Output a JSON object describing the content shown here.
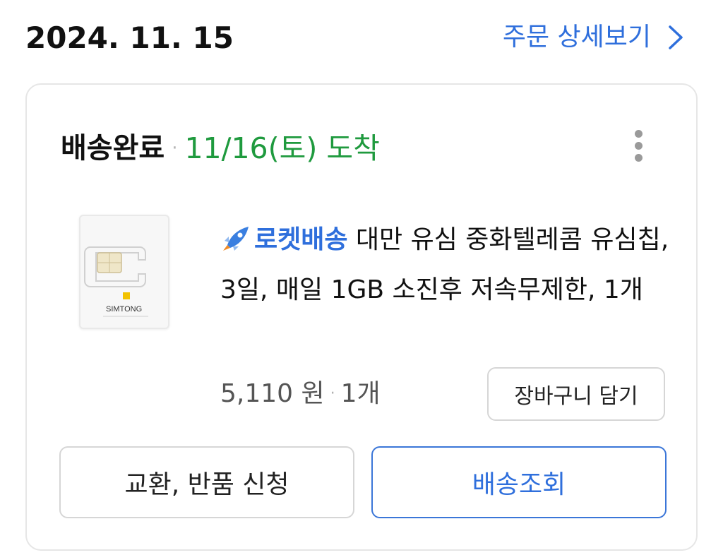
{
  "order": {
    "date": "2024. 11. 15",
    "detail_link": "주문 상세보기"
  },
  "shipment": {
    "status": "배송완료",
    "separator": "·",
    "arrival": "11/16(토) 도착"
  },
  "product": {
    "thumbnail_brand": "SIMTONG",
    "badge": "로켓배송",
    "title": "대만 유심 중화텔레콤 유심칩, 3일, 매일 1GB 소진후 저속무제한, 1개",
    "price": "5,110 원",
    "price_separator": "·",
    "quantity": "1개"
  },
  "actions": {
    "add_to_cart": "장바구니 담기",
    "exchange_return": "교환, 반품 신청",
    "track_delivery": "배송조회"
  },
  "colors": {
    "accent_blue": "#2f6fdc",
    "arrival_green": "#1f9a3e"
  },
  "icons": {
    "detail": "chevron-right-icon",
    "more": "more-vertical-icon",
    "badge": "rocket-icon"
  }
}
